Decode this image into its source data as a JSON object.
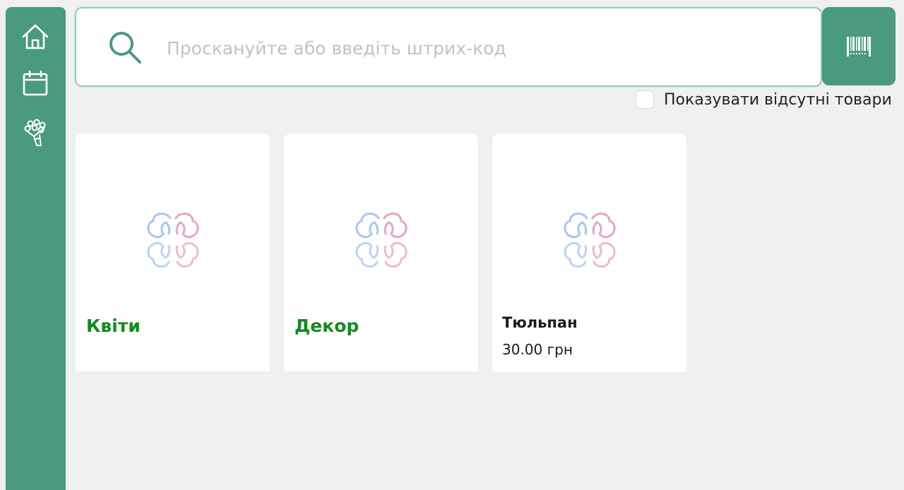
{
  "search": {
    "placeholder": "Проскануйте або введіть штрих-код",
    "value": ""
  },
  "filters": {
    "show_missing_label": "Показувати відсутні товари",
    "show_missing_checked": false
  },
  "colors": {
    "accent": "#4a9a7d",
    "category_text": "#148a20",
    "background": "#eef0f2"
  },
  "sidebar": {
    "items": [
      {
        "name": "home",
        "icon": "home-icon"
      },
      {
        "name": "calendar",
        "icon": "calendar-icon"
      },
      {
        "name": "bouquet",
        "icon": "bouquet-icon"
      }
    ]
  },
  "catalog": {
    "categories": [
      {
        "title": "Квіти"
      },
      {
        "title": "Декор"
      }
    ],
    "products": [
      {
        "title": "Тюльпан",
        "price": "30.00 грн"
      }
    ]
  }
}
